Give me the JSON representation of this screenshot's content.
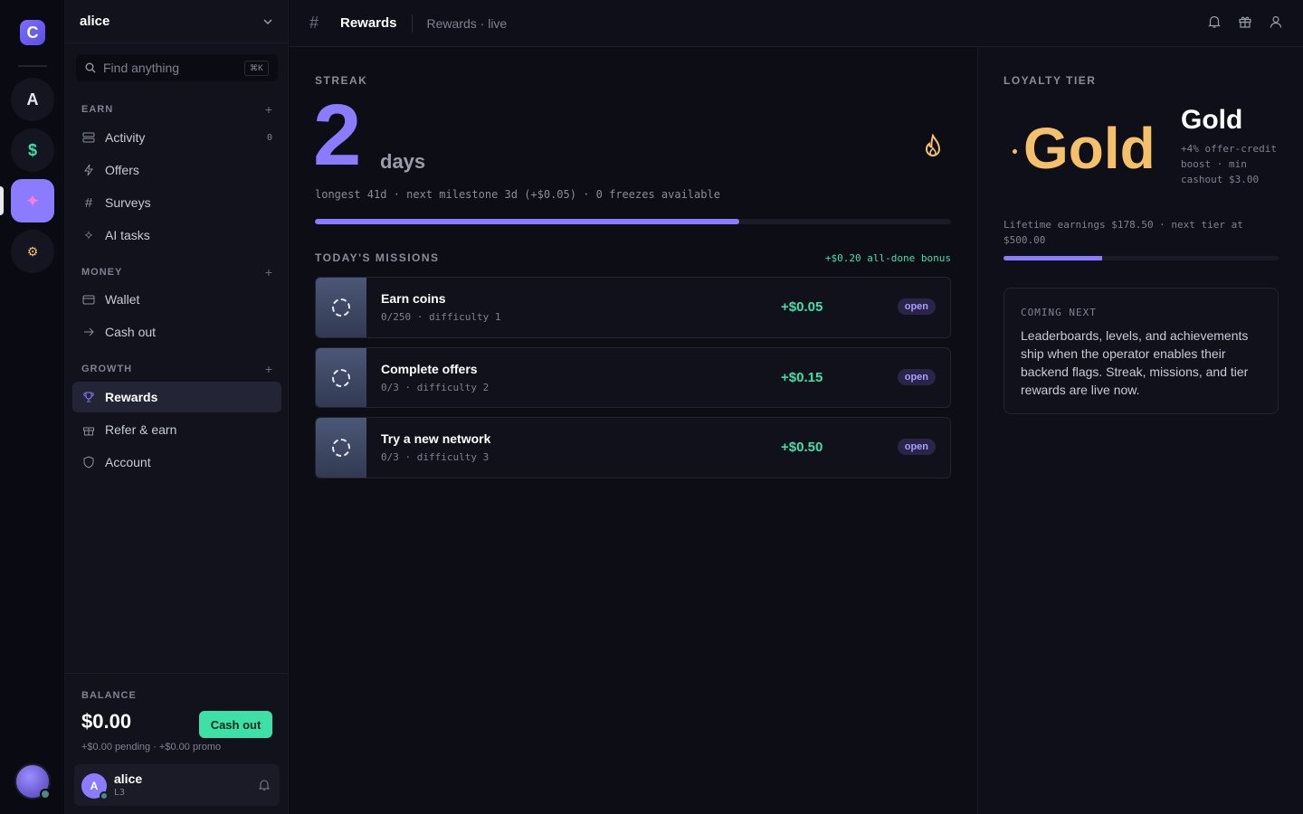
{
  "rail": {
    "logo_letter": "C",
    "workspaces": [
      {
        "label": "A",
        "icon": "letter"
      },
      {
        "label": "$",
        "icon": "dollar-icon"
      },
      {
        "label": "✦",
        "icon": "sparkle-icon"
      },
      {
        "label": "⚙",
        "icon": "gear-icon"
      }
    ]
  },
  "sidebar": {
    "workspace_name": "alice",
    "search": {
      "placeholder": "Find anything",
      "shortcut": "⌘K"
    },
    "sections": {
      "earn": "EARN",
      "money": "MONEY",
      "growth": "GROWTH"
    },
    "items": {
      "activity": {
        "label": "Activity",
        "count": "0"
      },
      "offers": {
        "label": "Offers"
      },
      "surveys": {
        "label": "Surveys"
      },
      "ai_tasks": {
        "label": "AI tasks"
      },
      "wallet": {
        "label": "Wallet"
      },
      "cash_out": {
        "label": "Cash out"
      },
      "rewards": {
        "label": "Rewards"
      },
      "refer": {
        "label": "Refer & earn"
      },
      "account": {
        "label": "Account"
      }
    },
    "balance": {
      "label": "BALANCE",
      "amount": "$0.00",
      "cash_out_label": "Cash out",
      "sub": "+$0.00 pending · +$0.00 promo"
    },
    "user": {
      "name": "alice",
      "level": "L3",
      "initial": "A"
    }
  },
  "topbar": {
    "title": "Rewards",
    "subtitle": "Rewards · live"
  },
  "streak": {
    "eyebrow": "STREAK",
    "number": "2",
    "unit": "days",
    "meta": "longest 41d · next milestone 3d (+$0.05) · 0 freezes available",
    "progress": 0.667
  },
  "missions": {
    "eyebrow": "TODAY'S MISSIONS",
    "bonus": "+$0.20 all-done bonus",
    "items": [
      {
        "title": "Earn coins",
        "sub": "0/250 · difficulty 1",
        "reward": "+$0.05",
        "status": "open"
      },
      {
        "title": "Complete offers",
        "sub": "0/3 · difficulty 2",
        "reward": "+$0.15",
        "status": "open"
      },
      {
        "title": "Try a new network",
        "sub": "0/3 · difficulty 3",
        "reward": "+$0.50",
        "status": "open"
      }
    ]
  },
  "tier": {
    "eyebrow": "LOYALTY TIER",
    "badge": "Gold",
    "title": "Gold",
    "desc": "+4% offer-credit boost · min cashout $3.00",
    "lifetime": "Lifetime earnings $178.50 · next tier at $500.00",
    "progress": 0.357
  },
  "coming": {
    "label": "COMING NEXT",
    "body": "Leaderboards, levels, and achievements ship when the operator enables their backend flags. Streak, missions, and tier rewards are live now."
  },
  "colors": {
    "accent": "#8b7bff",
    "money": "#3fe0a8",
    "gold": "#f5c06a"
  }
}
